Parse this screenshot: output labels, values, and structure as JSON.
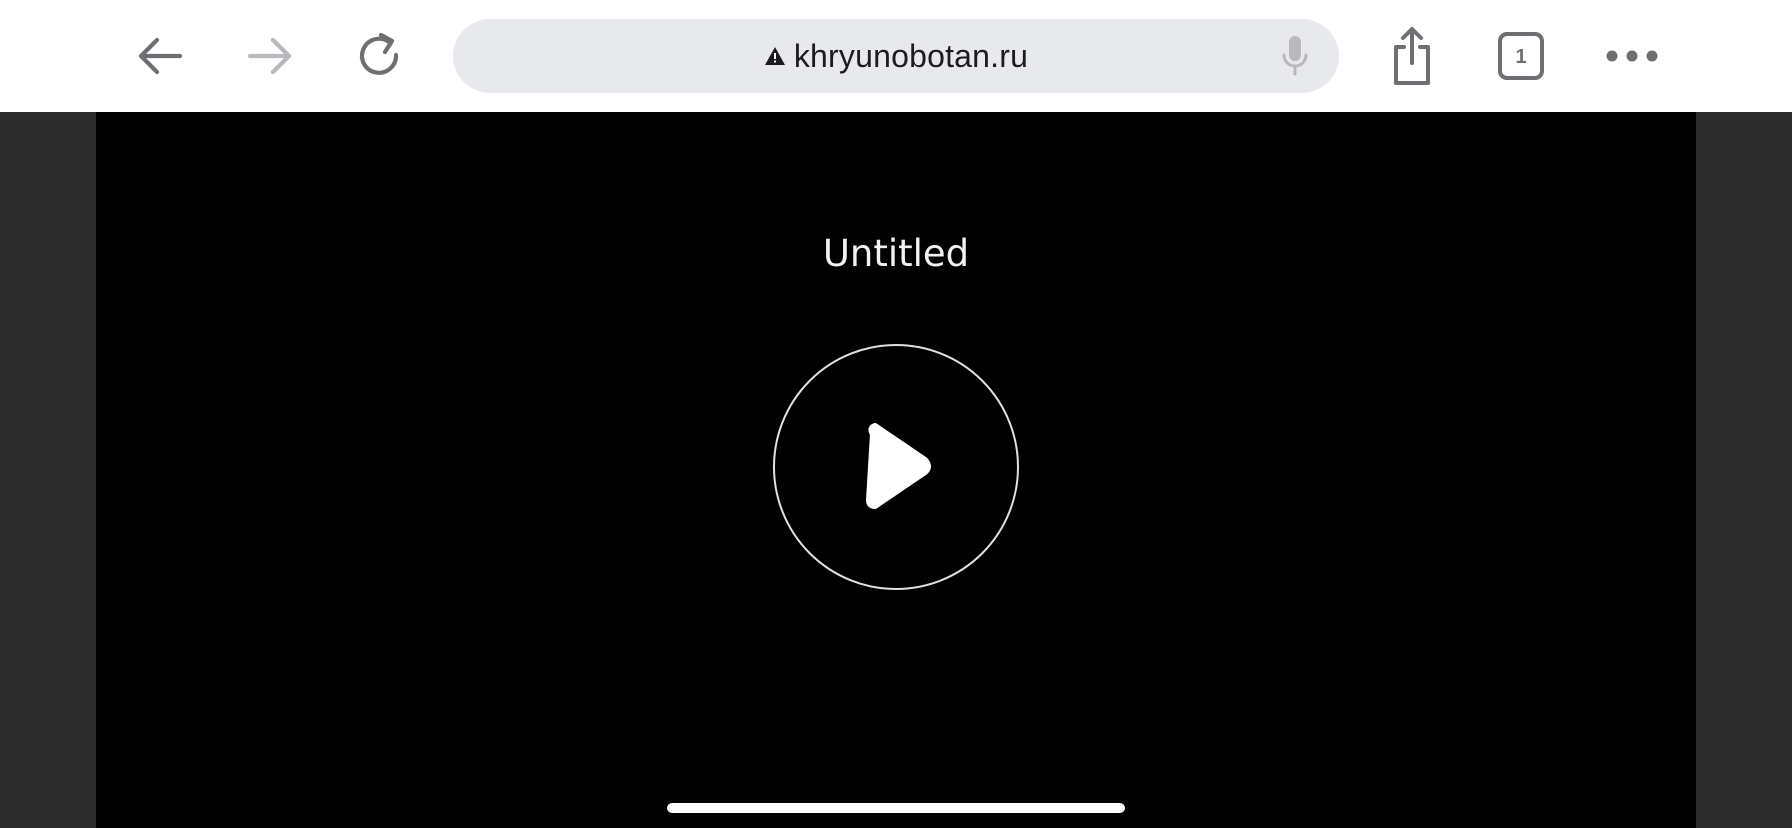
{
  "toolbar": {
    "back_icon": "arrow-left-icon",
    "forward_icon": "arrow-right-icon",
    "reload_icon": "reload-icon",
    "share_icon": "share-icon",
    "tabs_icon": "tabs-icon",
    "tab_count": "1",
    "more_icon": "ellipsis-icon"
  },
  "address_bar": {
    "url": "khryunobotan.ru",
    "security_icon": "warning-triangle-icon",
    "mic_icon": "microphone-icon"
  },
  "video": {
    "title": "Untitled",
    "play_icon": "play-icon"
  },
  "colors": {
    "toolbar_bg": "#ffffff",
    "address_bg": "#e8e9ec",
    "icon_gray": "#6e6e73",
    "icon_disabled": "#b8b8bd",
    "page_side_bg": "#2b2b2b",
    "video_bg": "#000000"
  }
}
